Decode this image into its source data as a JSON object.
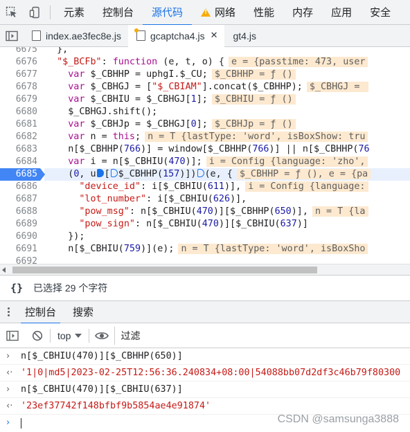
{
  "top_tabs": [
    "元素",
    "控制台",
    "源代码",
    "网络",
    "性能",
    "内存",
    "应用",
    "安全"
  ],
  "active_top_tab": "源代码",
  "file_tabs": [
    {
      "name": "index.ae3fec8e.js"
    },
    {
      "name": "gcaptcha4.js"
    },
    {
      "name": "gt4.js"
    }
  ],
  "code_lines": [
    {
      "n": "6675",
      "html": "        },"
    },
    {
      "n": "6676",
      "html": "        <span class='str'>\"$_BCFb\"</span>: <span class='kw'>function</span> (e, t, o) {<span class='inl'>e = {passtime: 473, user</span>"
    },
    {
      "n": "6677",
      "html": "            <span class='kw'>var</span> $_CBHHP = uphgI.$_CU;<span class='inl'>$_CBHHP = ƒ ()</span>"
    },
    {
      "n": "6678",
      "html": "            <span class='kw'>var</span> $_CBHGJ = [<span class='str'>\"$_CBIAM\"</span>].concat($_CBHHP);<span class='inl'>$_CBHGJ = </span>"
    },
    {
      "n": "6679",
      "html": "            <span class='kw'>var</span> $_CBHIU = $_CBHGJ[<span class='fn'>1</span>];<span class='inl'>$_CBHIU = ƒ ()</span>"
    },
    {
      "n": "6680",
      "html": "            $_CBHGJ.shift();"
    },
    {
      "n": "6681",
      "html": "            <span class='kw'>var</span> $_CBHJp = $_CBHGJ[<span class='fn'>0</span>];<span class='inl'>$_CBHJp = ƒ ()</span>"
    },
    {
      "n": "6682",
      "html": "            <span class='kw'>var</span> n = <span class='kw'>this</span>;<span class='inl'>n = T {lastType: 'word', isBoxShow: tru</span>"
    },
    {
      "n": "6683",
      "html": "            n[$_CBHHP(<span class='fn'>766</span>)] = window[$_CBHHP(<span class='fn'>766</span>)] || n[$_CBHHP(<span class='fn'>76</span>"
    },
    {
      "n": "6684",
      "html": "            <span class='kw'>var</span> i = n[$_CBHIU(<span class='fn'>470</span>)];<span class='inl'>i = Config {language: 'zho',</span>"
    },
    {
      "n": "6685",
      "exec": true,
      "html": "            (<span class='fn'>0</span>, u<span class='bp'></span>[<span class='bp o'></span>$_CBHHP(<span class='fn'>157</span>)])<span class='bp o'></span>(e, {<span class='inl'>$_CBHHP = ƒ (), e = {pa</span>"
    },
    {
      "n": "6686",
      "html": "              <span class='str'>\"device_id\"</span>: i[$_CBHIU(<span class='fn'>611</span>)],<span class='inl'>i = Config {language:</span>"
    },
    {
      "n": "6687",
      "html": "              <span class='str'>\"lot_number\"</span>: i[$_CBHIU(<span class='fn'>626</span>)],"
    },
    {
      "n": "6688",
      "html": "              <span class='str'>\"pow_msg\"</span>: n[$_CBHIU(<span class='fn'>470</span>)][$_CBHHP(<span class='fn'>650</span>)],<span class='inl'>n = T {la</span>"
    },
    {
      "n": "6689",
      "html": "              <span class='str'>\"pow_sign\"</span>: n[$_CBHIU(<span class='fn'>470</span>)][$_CBHIU(<span class='fn'>637</span>)]"
    },
    {
      "n": "6690",
      "html": "            });"
    },
    {
      "n": "6691",
      "html": "            n[$_CBHIU(<span class='fn'>759</span>)](e);<span class='inl'>n = T {lastType: 'word', isBoxSho</span>"
    },
    {
      "n": "6692",
      "html": ""
    }
  ],
  "status": {
    "selection": "已选择 29 个字符"
  },
  "drawer_tabs": [
    "控制台",
    "搜索"
  ],
  "console_toolbar": {
    "context": "top",
    "filter_placeholder": "过滤"
  },
  "console_lines": [
    {
      "kind": "input",
      "text": "n[$_CBHIU(470)][$_CBHHP(650)]"
    },
    {
      "kind": "result",
      "text": "'1|0|md5|2023-02-25T12:56:36.240834+08:00|54088bb07d2df3c46b79f80300"
    },
    {
      "kind": "input",
      "text": "n[$_CBHIU(470)][$_CBHIU(637)]"
    },
    {
      "kind": "result",
      "text": "'23ef37742f148bfbf9b5854ae4e91874'"
    }
  ],
  "watermark": "CSDN @samsunga3888",
  "colors": {
    "accent": "#1a73e8",
    "string": "#c41a16",
    "keyword": "#aa0d91",
    "inline_value_bg": "#fde9cf"
  }
}
